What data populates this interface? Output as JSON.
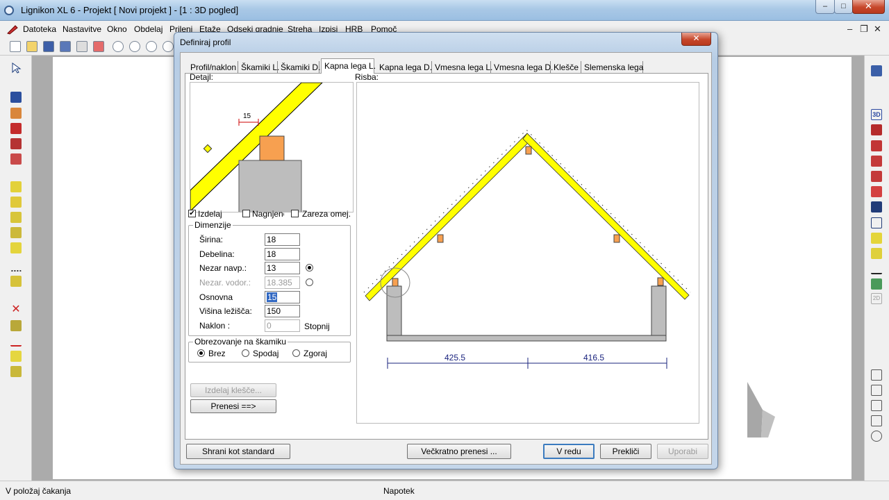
{
  "app": {
    "title": "Lignikon XL 6 - Projekt [ Novi projekt ]  - [1 : 3D pogled]",
    "menu": [
      "Datoteka",
      "Nastavitve",
      "Okno",
      "Obdelaj",
      "Prileni",
      "Etaže",
      "Odseki gradnje",
      "Streha",
      "Izpisi",
      "HRB",
      "Pomoč"
    ],
    "window_controls": {
      "minimize": "–",
      "maximize": "□",
      "close": "✕"
    },
    "mdi_controls": {
      "minimize": "–",
      "restore": "❐",
      "close": "✕"
    }
  },
  "status": {
    "left": "V položaj čakanja",
    "center": "Napotek"
  },
  "dialog": {
    "title": "Definiraj profil",
    "close_glyph": "✕",
    "tabs": [
      "Profil/naklon",
      "Škamiki L.",
      "Škamiki D.",
      "Kapna lega L.",
      "Kapna lega D.",
      "Vmesna lega L.",
      "Vmesna lega D.",
      "Klešče",
      "Slemenska lega"
    ],
    "active_tab": 3,
    "detail_label": "Detajl:",
    "detail_dimension": "15",
    "risba_label": "Risba:",
    "checkboxes": [
      {
        "label": "Izdelaj",
        "checked": true
      },
      {
        "label": "Nagnjeno",
        "checked": false
      },
      {
        "label": "Zareza omej.",
        "checked": false
      }
    ],
    "dimenzije": {
      "title": "Dimenzije",
      "rows": [
        {
          "label": "Širina:",
          "value": "18"
        },
        {
          "label": "Debelina:",
          "value": "18"
        },
        {
          "label": "Nezar navp.:",
          "value": "13"
        },
        {
          "label": "Nezar. vodor.:",
          "value": "18.385"
        },
        {
          "label": "Osnovna",
          "value": "15"
        },
        {
          "label": "Višina ležišča:",
          "value": "150"
        },
        {
          "label": "Naklon :",
          "value": "0"
        }
      ],
      "unit": "Stopnij"
    },
    "obrezovanje": {
      "title": "Obrezovanje na škamiku",
      "options": [
        "Brez",
        "Spodaj",
        "Zgoraj"
      ],
      "selected": 0
    },
    "buttons": {
      "izdelaj_klesce": "Izdelaj klešče...",
      "prenesi": "Prenesi ==>",
      "shrani": "Shrani kot standard",
      "veckratno": "Večkratno prenesi ...",
      "ok": "V redu",
      "preklici": "Prekliči",
      "uporabi": "Uporabi"
    },
    "drawing": {
      "dim_left": "425.5",
      "dim_right": "416.5"
    }
  }
}
